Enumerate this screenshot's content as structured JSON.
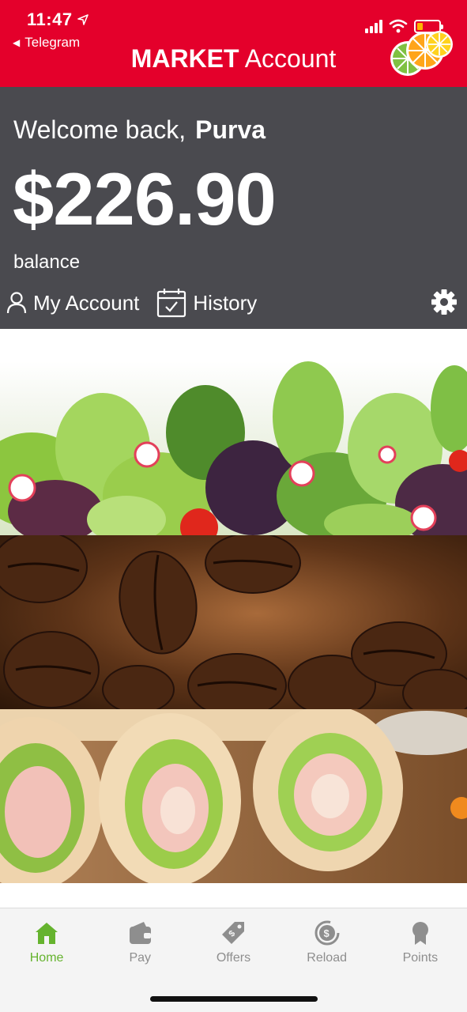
{
  "status_bar": {
    "time": "11:47",
    "back_app": "Telegram"
  },
  "header": {
    "title_bold": "MARKET",
    "title_rest": "Account",
    "colors": {
      "brand_red": "#e4002b"
    }
  },
  "account": {
    "greeting": "Welcome back,",
    "user_name": "Purva",
    "balance": "$226.90",
    "balance_label": "balance",
    "nav": {
      "my_account": "My Account",
      "history": "History"
    },
    "colors": {
      "panel_bg": "#4a4a4f"
    }
  },
  "promo": {
    "images": [
      "salad-greens",
      "coffee-beans",
      "wrap-sandwiches"
    ]
  },
  "tabbar": {
    "active": "Home",
    "tabs": [
      {
        "label": "Home",
        "icon": "home-icon"
      },
      {
        "label": "Pay",
        "icon": "wallet-icon"
      },
      {
        "label": "Offers",
        "icon": "tag-icon"
      },
      {
        "label": "Reload",
        "icon": "reload-icon"
      },
      {
        "label": "Points",
        "icon": "award-icon"
      }
    ],
    "colors": {
      "active": "#65b32e",
      "inactive": "#8e8e8e"
    }
  }
}
